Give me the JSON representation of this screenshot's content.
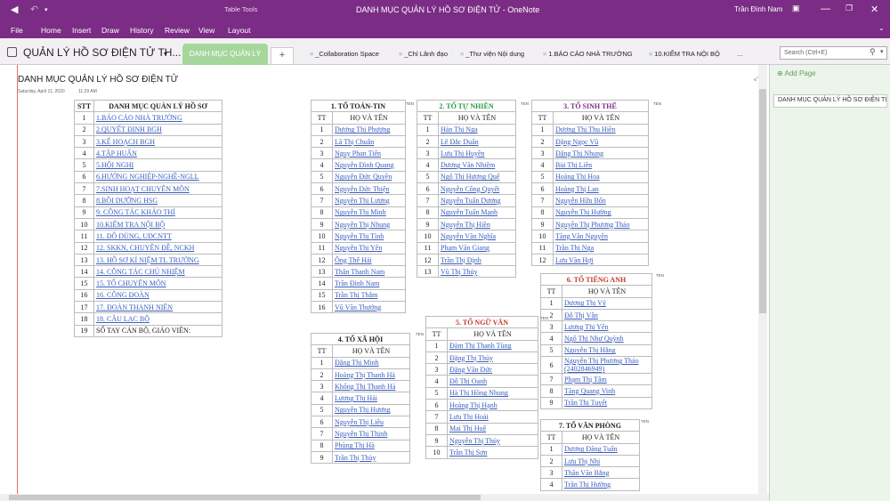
{
  "app": {
    "title": "DANH MỤC QUẢN LÝ HỒ SƠ ĐIỆN TỬ  -  OneNote",
    "contextual": "Table Tools",
    "user": "Trần Đình Nam",
    "menus": [
      "File",
      "Home",
      "Insert",
      "Draw",
      "History",
      "Review",
      "View",
      "Layout"
    ]
  },
  "notebook": {
    "name": "QUẢN LÝ HỒ SƠ ĐIỆN TỬ TH...",
    "active_section": "DANH MỤC QUẢN LÝ",
    "add_section": "+",
    "sections": [
      "_Collaboration Space",
      "_Chỉ Lãnh đạo",
      "_Thư viện Nội dung",
      "1.BÁO CÁO NHÀ TRƯỜNG",
      "10.KIỂM TRA NỘI BỘ",
      "..."
    ]
  },
  "search": {
    "placeholder": "Search (Ctrl+E)"
  },
  "pages_panel": {
    "add_label": "Add Page",
    "items": [
      "DANH MỤC QUẢN LÝ HỒ SƠ ĐIỆN TỬ"
    ]
  },
  "page": {
    "title": "DANH MỤC QUẢN LÝ HỒ SƠ ĐIỆN TỬ",
    "date": "Saturday, April 11, 2020",
    "time": "11:29 AM"
  },
  "tag": "TEN",
  "catalog": {
    "headers": [
      "STT",
      "DANH MỤC QUẢN LÝ HỒ SƠ"
    ],
    "rows": [
      [
        "1",
        "1.BÁO CÁO NHÀ TRƯỜNG",
        true
      ],
      [
        "2",
        "2.QUYẾT ĐỊNH BGH",
        true
      ],
      [
        "3",
        "3.KẾ HOẠCH BGH",
        true
      ],
      [
        "4",
        "4.TẬP HUẤN",
        true
      ],
      [
        "5",
        "5.HỘI NGHỊ",
        true
      ],
      [
        "6",
        "6.HƯỚNG NGHIỆP-NGHỀ-NGLL",
        true
      ],
      [
        "7",
        "7.SINH HOẠT CHUYÊN MÔN",
        true
      ],
      [
        "8",
        "8.BỒI DƯỠNG HSG",
        true
      ],
      [
        "9",
        "9. CÔNG TÁC KHẢO THÍ",
        true
      ],
      [
        "10",
        "10.KIỂM TRA NỘI BỘ",
        true
      ],
      [
        "11",
        "11. ĐỒ DÙNG, UDCNTT",
        true
      ],
      [
        "12",
        "12. SKKN, CHUYÊN ĐỀ, NCKH",
        true
      ],
      [
        "13",
        "13. HỒ SƠ KỈ NIỆM TL TRƯỜNG",
        true
      ],
      [
        "14",
        "14. CÔNG TÁC CHỦ NHIỆM",
        true
      ],
      [
        "15",
        "15. TỔ CHUYÊN MÔN",
        true
      ],
      [
        "16",
        "16. CÔNG ĐOÀN",
        true
      ],
      [
        "17",
        "17. ĐOÀN THANH NIÊN",
        true
      ],
      [
        "18",
        "18. CÂU LẠC BỘ",
        true
      ],
      [
        "19",
        "SỔ TAY CÁN BỘ, GIÁO VIÊN:",
        false
      ]
    ]
  },
  "groups": [
    {
      "id": "toan",
      "title": "1. TỔ TOÁN-TIN",
      "color": "#222222",
      "headers": [
        "TT",
        "HỌ VÀ TÊN"
      ],
      "names": [
        "Dương Thị Phượng",
        "Lã Thị Chuân",
        "Nguy Phan Tiến",
        "Nguyễn Đình Quang",
        "Nguyễn Đức Quyền",
        "Nguyễn Đức Thiện",
        "Nguyễn Thị Lượng",
        "Nguyễn Thị Minh",
        "Nguyễn Thị Nhung",
        "Nguyễn Thị Tình",
        "Nguyễn Thị Yến",
        "Ông Thế Hải",
        "Thân Thanh Nam",
        "Trần Đình Nam",
        "Trần Thị Thắm",
        "Vũ Văn Thưởng"
      ]
    },
    {
      "id": "tunhien",
      "title": "2. TỔ TỰ NHIÊN",
      "color": "#1f9a3c",
      "headers": [
        "TT",
        "HỌ VÀ TÊN"
      ],
      "names": [
        "Hán Thị Nga",
        "Lê Đắc Duẩn",
        "Lưu Thị Huyền",
        "Dương Văn Nhiệm",
        "Ngô Thị Hương Quế",
        "Nguyễn Công Quyết",
        "Nguyễn Tuấn Dương",
        "Nguyễn Tuấn Mạnh",
        "Nguyễn Thị Hiền",
        "Nguyễn Văn Nghĩa",
        "Phạm Văn Giang",
        "Trần Thị Định",
        "Vũ Thị Thủy"
      ]
    },
    {
      "id": "sinh",
      "title": "3. TỔ SINH THỂ",
      "color": "#7b2c85",
      "headers": [
        "TT",
        "HỌ VÀ TÊN"
      ],
      "names": [
        "Dương Thị Thu Hiền",
        "Đặng Ngọc Vũ",
        "Đặng Thị Nhung",
        "Bùi Thị Liên",
        "Hoàng Thị Hoa",
        "Hoàng Thị Lan",
        "Nguyễn Hữu Bốn",
        "Nguyễn Thị Hường",
        "Nguyễn Thị Phương Thảo",
        "Tăng Văn Nguyện",
        "Trần Thị Nga",
        "Lưu Văn Hợi"
      ]
    },
    {
      "id": "xahoi",
      "title": "4. TỔ XÃ HỘI",
      "color": "#222222",
      "headers": [
        "TT",
        "HỌ VÀ TÊN"
      ],
      "names": [
        "Đặng Thị Minh",
        "Hoàng Thị Thanh Hà",
        "Khổng Thị Thanh Hà",
        "Lương Thị Hải",
        "Nguyễn Thị Hương",
        "Nguyễn Thị Liễu",
        "Nguyễn Thị Thịnh",
        "Phùng Thị Hà",
        "Trần Thị Thủy"
      ]
    },
    {
      "id": "nguvan",
      "title": "5. TỔ NGỮ VĂN",
      "color": "#c0392b",
      "headers": [
        "TT",
        "HỌ VÀ TÊN"
      ],
      "names": [
        "Đàm Thị Thanh Tùng",
        "Đặng Thị Thủy",
        "Đặng Văn Đức",
        "Đỗ Thị Oanh",
        "Hà Thị Hồng Nhung",
        "Hoàng Thị Hạnh",
        "Lưu Thị Hoài",
        "Mai Thị Huệ",
        "Nguyễn Thị Thủy",
        "Trần Thị Sơn"
      ]
    },
    {
      "id": "anh",
      "title": "6. TỔ TIẾNG ANH",
      "color": "#c0392b",
      "headers": [
        "TT",
        "HỌ VÀ TÊN"
      ],
      "names": [
        "Dương Thị Vỹ",
        "Đỗ Thị Vân",
        "Lương Thị Yến",
        "Ngô Thị Như Quỳnh",
        "Nguyễn Thị Hằng",
        "Nguyễn Thị Phương Thảo (2402846949)",
        "Phạm Thị Tâm",
        "Tăng Quang Vinh",
        "Trần Thị Tuyết"
      ]
    },
    {
      "id": "vanphong",
      "title": "7. TỔ VĂN PHÒNG",
      "color": "#222222",
      "headers": [
        "TT",
        "HỌ VÀ TÊN"
      ],
      "names": [
        "Dương Đăng Tuấn",
        "Lưu Thị Nhi",
        "Thân Văn Bằng",
        "Trần Thị Hường"
      ]
    }
  ]
}
